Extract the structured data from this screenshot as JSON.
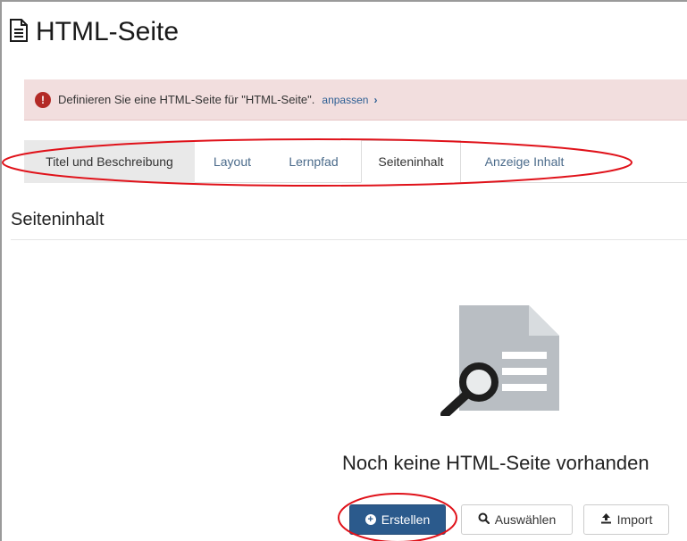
{
  "header": {
    "title": "HTML-Seite",
    "icon": "document-icon"
  },
  "alert": {
    "message": "Definieren Sie eine HTML-Seite für \"HTML-Seite\".",
    "link_label": "anpassen",
    "chevron": "›",
    "icon_glyph": "!",
    "color": "#f2dede"
  },
  "tabs": [
    {
      "label": "Titel und Beschreibung"
    },
    {
      "label": "Layout"
    },
    {
      "label": "Lernpfad"
    },
    {
      "label": "Seiteninhalt",
      "active": true
    },
    {
      "label": "Anzeige Inhalt"
    }
  ],
  "section": {
    "title": "Seiteninhalt"
  },
  "empty_state": {
    "message": "Noch keine HTML-Seite vorhanden",
    "icon": "document-search-icon"
  },
  "actions": {
    "create_label": "Erstellen",
    "select_label": "Auswählen",
    "import_label": "Import"
  },
  "colors": {
    "accent": "#2b5a8c",
    "annotation": "#e0121a",
    "alert_bg": "#f2dede"
  }
}
